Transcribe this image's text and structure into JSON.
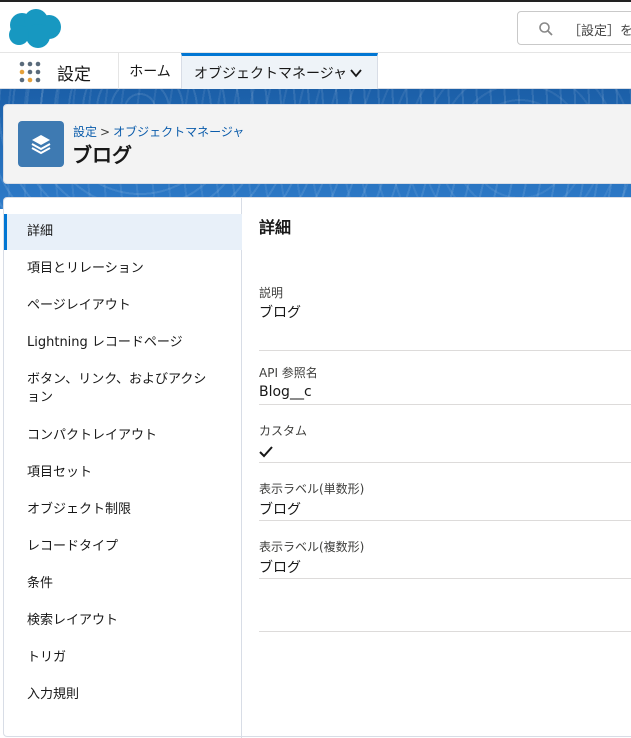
{
  "header": {
    "search_placeholder": "［設定］を検"
  },
  "nav": {
    "app_name": "設定",
    "tabs": [
      {
        "label": "ホーム"
      },
      {
        "label": "オブジェクトマネージャ"
      }
    ]
  },
  "page_header": {
    "breadcrumb": [
      "設定",
      "オブジェクトマネージャ"
    ],
    "breadcrumb_sep": ">",
    "title": "ブログ"
  },
  "sidebar": {
    "items": [
      {
        "label": "詳細"
      },
      {
        "label": "項目とリレーション"
      },
      {
        "label": "ページレイアウト"
      },
      {
        "label": "Lightning レコードページ"
      },
      {
        "label": "ボタン、リンク、およびアクシ"
      },
      {
        "label": "ョン"
      },
      {
        "label": "コンパクトレイアウト"
      },
      {
        "label": "項目セット"
      },
      {
        "label": "オブジェクト制限"
      },
      {
        "label": "レコードタイプ"
      },
      {
        "label": "条件"
      },
      {
        "label": "検索レイアウト"
      },
      {
        "label": "トリガ"
      },
      {
        "label": "入力規則"
      }
    ]
  },
  "details": {
    "title": "詳細",
    "fields": [
      {
        "label": "説明",
        "value": "ブログ"
      },
      {
        "label": "API 参照名",
        "value": "Blog__c"
      },
      {
        "label": "カスタム",
        "value": ""
      },
      {
        "label": "表示ラベル(単数形)",
        "value": "ブログ"
      },
      {
        "label": "表示ラベル(複数形)",
        "value": "ブログ"
      }
    ]
  },
  "colors": {
    "brand": "#0176d3",
    "band": "#1b5fa8",
    "object_icon": "#3e7ab2"
  }
}
